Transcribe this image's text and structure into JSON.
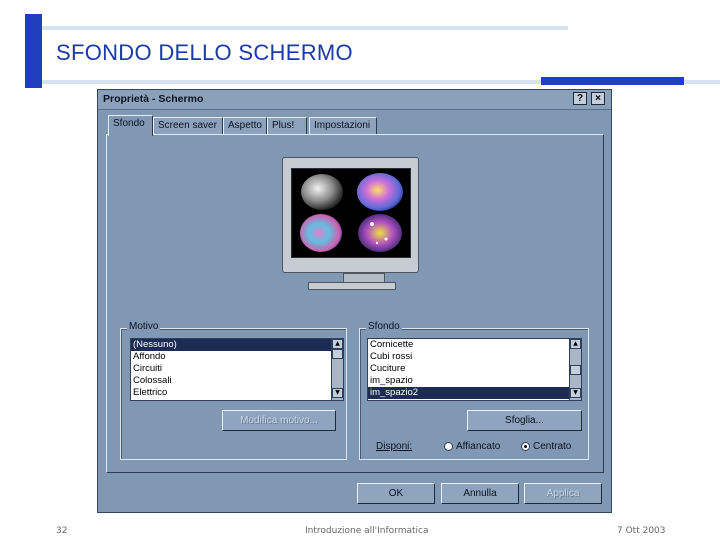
{
  "slide": {
    "title": "SFONDO DELLO SCHERMO",
    "footer_left": "32",
    "footer_center": "Introduzione all'Informatica",
    "footer_right": "7 Ott 2003"
  },
  "dialog": {
    "title": "Proprietà - Schermo",
    "help_label": "?",
    "close_label": "×",
    "tabs": [
      {
        "label": "Sfondo",
        "active": true
      },
      {
        "label": "Screen saver"
      },
      {
        "label": "Aspetto"
      },
      {
        "label": "Plus!"
      },
      {
        "label": "Impostazioni"
      }
    ],
    "motivo": {
      "legend": "Motivo",
      "items": [
        "(Nessuno)",
        "Affondo",
        "Circuiti",
        "Colossali",
        "Elettrico"
      ],
      "selected_index": 0,
      "edit_button": "Modifica motivo..."
    },
    "sfondo": {
      "legend": "Sfondo",
      "items": [
        "Cornicette",
        "Cubi rossi",
        "Cuciture",
        "im_spazio",
        "im_spazio2"
      ],
      "selected_index": 4,
      "browse_button": "Sfoglia...",
      "display_label": "Disponi:",
      "options": [
        {
          "label": "Affiancato",
          "checked": false
        },
        {
          "label": "Centrato",
          "checked": true
        }
      ]
    },
    "buttons": {
      "ok": "OK",
      "cancel": "Annulla",
      "apply": "Applica"
    }
  }
}
